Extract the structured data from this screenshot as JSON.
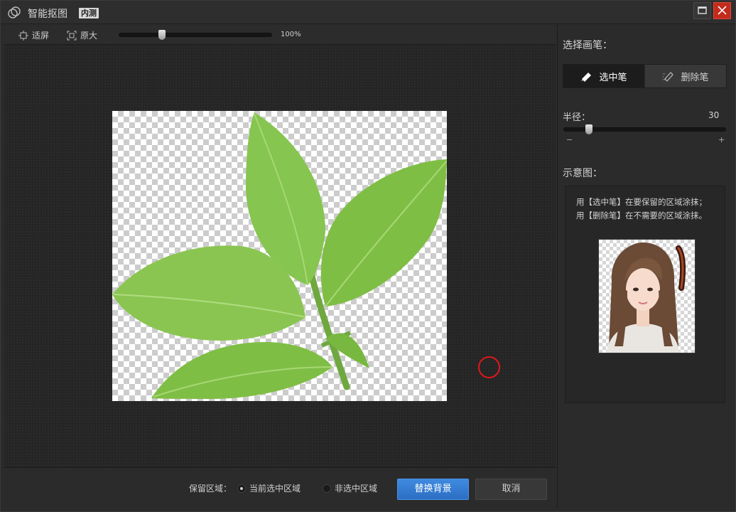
{
  "titlebar": {
    "app_title": "智能抠图",
    "badge": "内测"
  },
  "toolbar": {
    "fit_label": "适屏",
    "original_label": "原大",
    "zoom_percent": "100%",
    "zoom_value": 0.27
  },
  "footer": {
    "keep_label": "保留区域：",
    "option_current": "当前选中区域",
    "option_non": "非选中区域",
    "selected_option": "当前选中区域",
    "replace_button": "替换背景",
    "cancel_button": "取消"
  },
  "panel": {
    "brush_title": "选择画笔：",
    "brush_select": "选中笔",
    "brush_delete": "删除笔",
    "active_brush": "选中笔",
    "radius_label": "半径：",
    "radius_value": "30",
    "radius_minus": "−",
    "radius_plus": "+",
    "demo_title": "示意图：",
    "demo_line1": "用【选中笔】在要保留的区域涂抹；",
    "demo_line2": "用【删除笔】在不需要的区域涂抹。"
  },
  "colors": {
    "accent": "#2f7bd6",
    "close": "#c42b1c",
    "cursor": "#e01818",
    "leaf": "#7fc24a"
  },
  "icons": [
    "app-logo-icon",
    "maximize-icon",
    "close-icon",
    "fit-screen-icon",
    "original-size-icon",
    "select-brush-icon",
    "delete-brush-icon"
  ]
}
